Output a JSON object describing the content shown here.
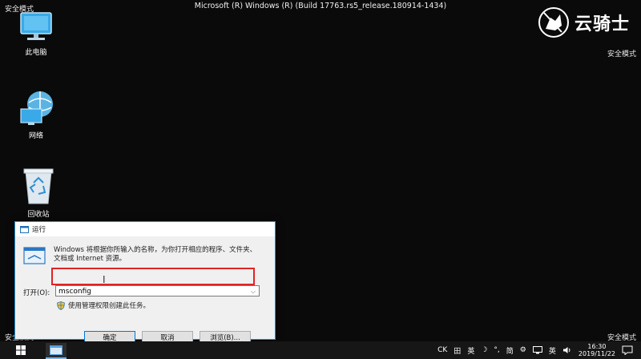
{
  "window_title": "Microsoft (R) Windows (R) (Build 17763.rs5_release.180914-1434)",
  "safe_mode_label": "安全模式",
  "watermark_text": "云骑士",
  "desktop": {
    "icons": [
      {
        "label": "此电脑",
        "icon": "computer-icon"
      },
      {
        "label": "网络",
        "icon": "network-icon"
      },
      {
        "label": "回收站",
        "icon": "recycle-bin-icon"
      }
    ]
  },
  "run_dialog": {
    "title": "运行",
    "description": "Windows 将根据你所输入的名称，为你打开相应的程序、文件夹、文档或 Internet 资源。",
    "open_label": "打开(O):",
    "input_value": "msconfig",
    "admin_note": "使用管理权限创建此任务。",
    "buttons": {
      "ok": "确定",
      "cancel": "取消",
      "browse": "浏览(B)..."
    }
  },
  "taskbar": {
    "tray": {
      "ck": "CK",
      "ime1": "田",
      "lang1": "英",
      "moon": "☽",
      "dot": "°,",
      "ime2": "简",
      "gear": "⚙",
      "lang2": "英",
      "time": "16:30",
      "date": "2019/11/22"
    }
  },
  "colors": {
    "accent": "#0078d7",
    "highlight": "#e02424",
    "desktop_bg": "#0a0a0a"
  }
}
